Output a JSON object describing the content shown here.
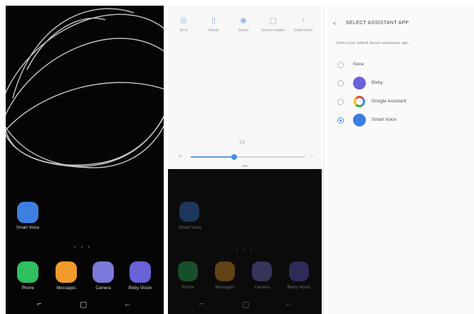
{
  "home": {
    "featured_app": {
      "label": "Smart Voice",
      "color": "#3d7fe0",
      "icon": "music-note-icon"
    },
    "page_indicator": "• • •",
    "dock": [
      {
        "label": "Phone",
        "color": "#2fbf5f",
        "icon": "phone-icon"
      },
      {
        "label": "Messages",
        "color": "#f29a2b",
        "icon": "message-icon"
      },
      {
        "label": "Camera",
        "color": "#7b79d9",
        "icon": "camera-icon"
      },
      {
        "label": "Bixby Vision",
        "color": "#6a62d8",
        "icon": "eye-icon"
      }
    ],
    "nav": {
      "recents": "⌐",
      "home": "▢",
      "back": "←"
    }
  },
  "quick_settings": {
    "tiles": [
      {
        "label": "Wi-Fi",
        "icon": "wifi-icon",
        "glyph": "◎",
        "active": true
      },
      {
        "label": "Vibrate",
        "icon": "vibrate-icon",
        "glyph": "▯",
        "active": false
      },
      {
        "label": "Sound",
        "icon": "sound-icon",
        "glyph": "◉",
        "active": true
      },
      {
        "label": "Screen rotation",
        "icon": "rotation-icon",
        "glyph": "▢",
        "active": false
      },
      {
        "label": "Smart Voice",
        "icon": "assistant-icon",
        "glyph": "♪",
        "active": true
      }
    ],
    "page_num": "1/2",
    "brightness": {
      "value": 0.38,
      "sun": "☼",
      "auto": "○"
    }
  },
  "assistant_settings": {
    "back": "<",
    "title": "SELECT ASSISTANT APP",
    "subtitle": "Select your default device assistance app.",
    "options": [
      {
        "label": "None",
        "icon": "",
        "color": "",
        "selected": false
      },
      {
        "label": "Bixby",
        "icon": "bixby-icon",
        "color": "#6a62d8",
        "selected": false
      },
      {
        "label": "Google Assistant",
        "icon": "google-icon",
        "color": "#ffffff",
        "selected": false
      },
      {
        "label": "Smart Voice",
        "icon": "music-note-icon",
        "color": "#3d7fe0",
        "selected": true
      }
    ]
  }
}
